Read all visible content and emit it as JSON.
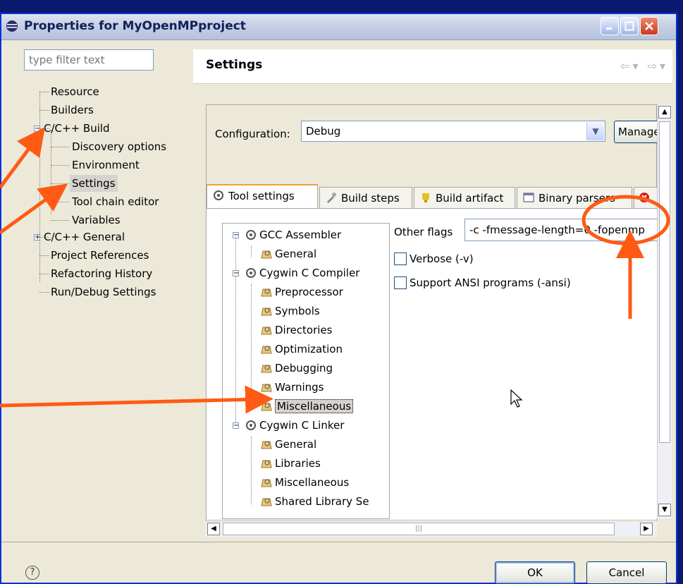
{
  "window": {
    "title": "Properties for MyOpenMPproject"
  },
  "filter": {
    "placeholder": "type filter text"
  },
  "left_tree": {
    "items": [
      {
        "label": "Resource"
      },
      {
        "label": "Builders"
      },
      {
        "label": "C/C++ Build"
      },
      {
        "label": "Discovery options"
      },
      {
        "label": "Environment"
      },
      {
        "label": "Settings"
      },
      {
        "label": "Tool chain editor"
      },
      {
        "label": "Variables"
      },
      {
        "label": "C/C++ General"
      },
      {
        "label": "Project References"
      },
      {
        "label": "Refactoring History"
      },
      {
        "label": "Run/Debug Settings"
      }
    ]
  },
  "header": {
    "title": "Settings"
  },
  "configuration": {
    "label": "Configuration:",
    "value": "Debug",
    "manage_label": "Manage"
  },
  "tabs": [
    {
      "label": "Tool settings"
    },
    {
      "label": "Build steps"
    },
    {
      "label": "Build artifact"
    },
    {
      "label": "Binary parsers"
    }
  ],
  "tool_tree": {
    "items": [
      {
        "label": "GCC Assembler"
      },
      {
        "label": "General"
      },
      {
        "label": "Cygwin C Compiler"
      },
      {
        "label": "Preprocessor"
      },
      {
        "label": "Symbols"
      },
      {
        "label": "Directories"
      },
      {
        "label": "Optimization"
      },
      {
        "label": "Debugging"
      },
      {
        "label": "Warnings"
      },
      {
        "label": "Miscellaneous"
      },
      {
        "label": "Cygwin C Linker"
      },
      {
        "label": "General"
      },
      {
        "label": "Libraries"
      },
      {
        "label": "Miscellaneous"
      },
      {
        "label": "Shared Library Se"
      }
    ]
  },
  "options": {
    "other_flags_label": "Other flags",
    "other_flags_value": "-c -fmessage-length=0 -fopenmp",
    "verbose_label": "Verbose (-v)",
    "ansi_label": "Support ANSI programs (-ansi)"
  },
  "buttons": {
    "ok": "OK",
    "cancel": "Cancel"
  },
  "colors": {
    "annotation": "#ff5a14",
    "window_border": "#0831d9",
    "background": "#0b1a6e"
  }
}
